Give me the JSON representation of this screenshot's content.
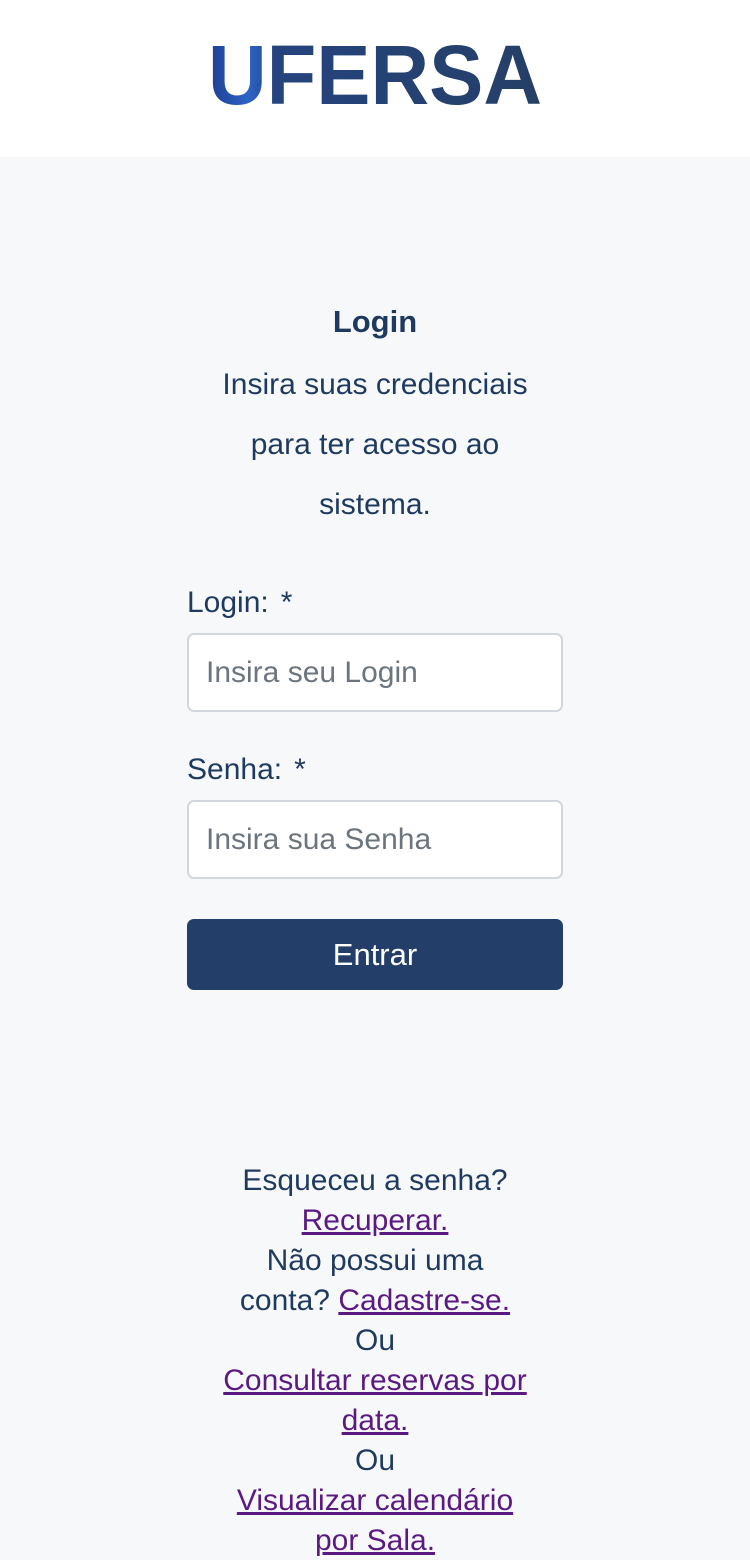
{
  "header": {
    "logo_text": "UFERSA"
  },
  "intro": {
    "title": "Login",
    "subtitle": "Insira suas credenciais para ter acesso ao sistema."
  },
  "form": {
    "login_label": "Login:",
    "login_required": "*",
    "login_placeholder": "Insira seu Login",
    "password_label": "Senha:",
    "password_required": "*",
    "password_placeholder": "Insira sua Senha",
    "submit_label": "Entrar"
  },
  "links": {
    "forgot_text": "Esqueceu a senha?",
    "recover_link": "Recuperar.",
    "no_account_text": "Não possui uma conta?",
    "signup_link": "Cadastre-se.",
    "or_1": "Ou",
    "reservations_link": "Consultar reservas por data.",
    "or_2": "Ou",
    "calendar_link": "Visualizar calendário por Sala."
  },
  "colors": {
    "primary": "#233e68",
    "text": "#1f3a5f",
    "link": "#5a1a82",
    "background": "#f7f8fa"
  }
}
